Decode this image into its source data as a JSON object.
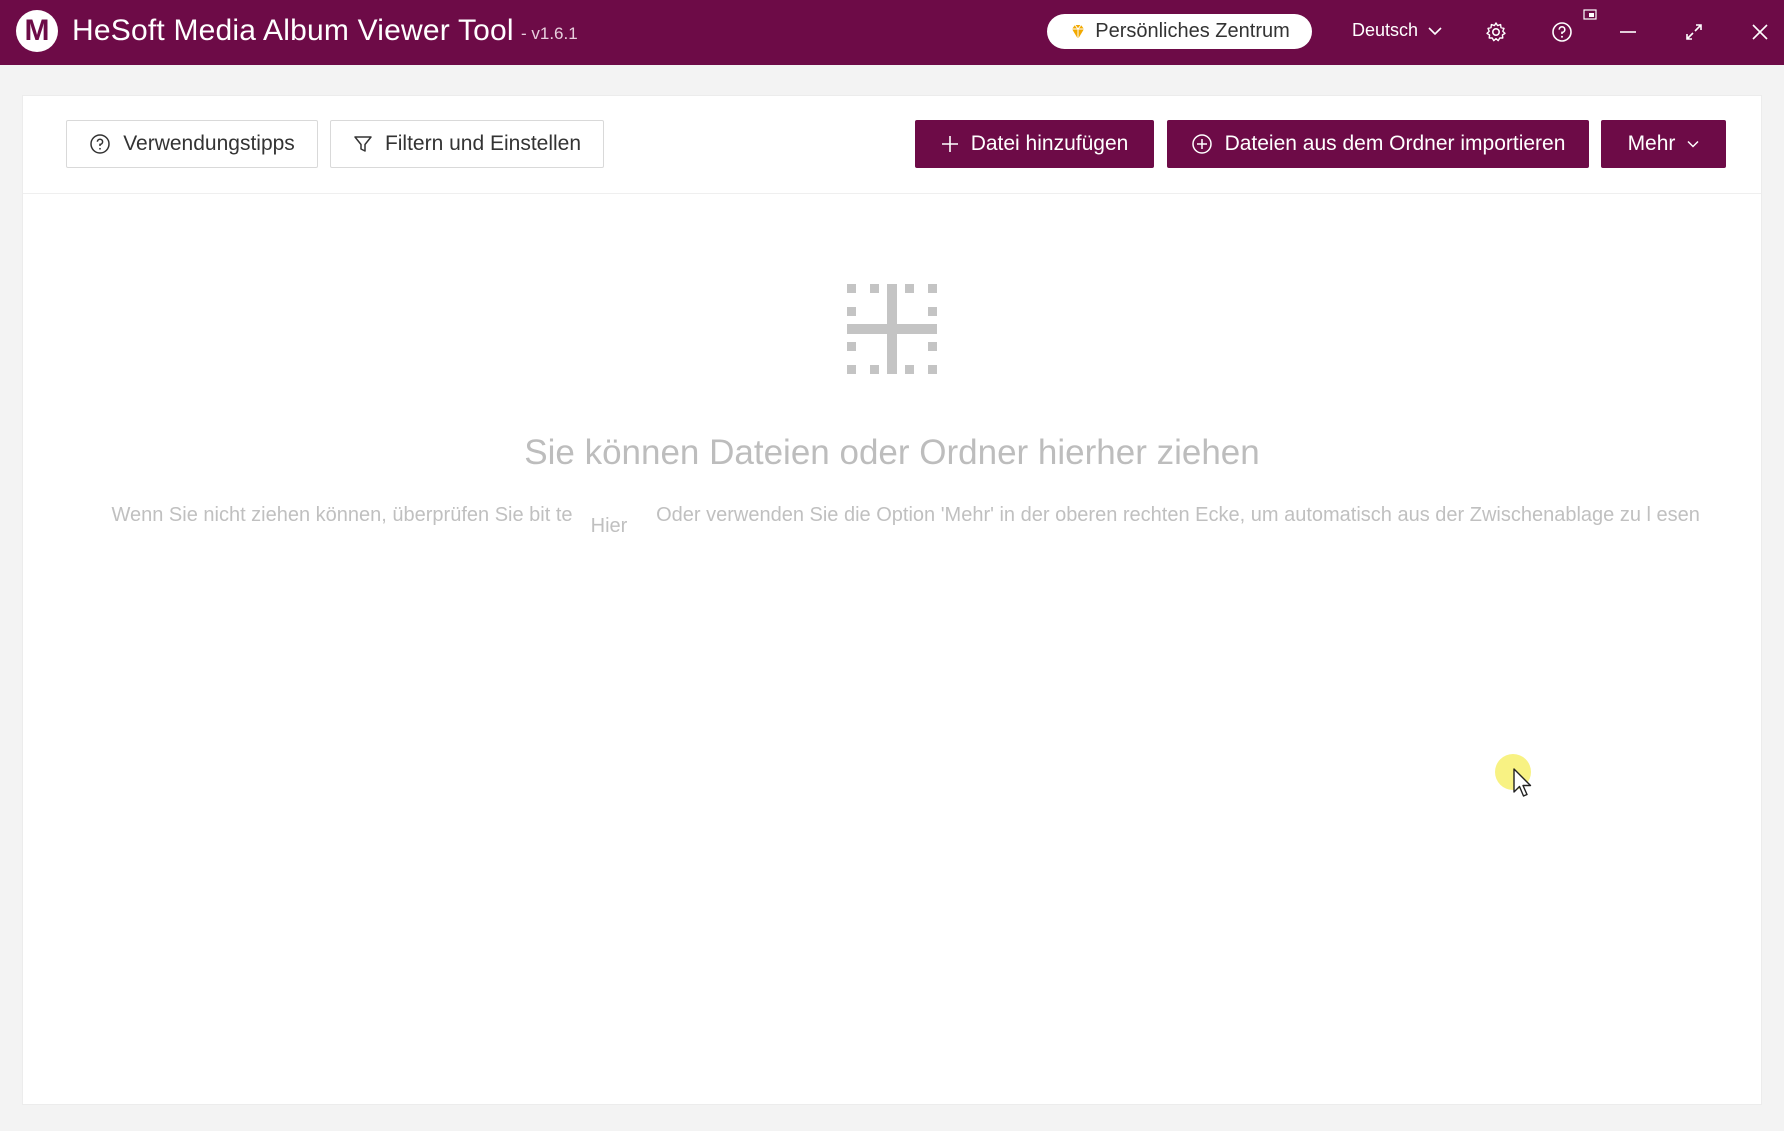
{
  "titlebar": {
    "logo_letter": "M",
    "app_title": "HeSoft Media Album Viewer Tool",
    "version": "- v1.6.1",
    "personal_center": "Persönliches Zentrum",
    "language": "Deutsch",
    "icons": [
      "gem-icon",
      "chevron-down-icon",
      "gear-icon",
      "help-icon",
      "window-icon",
      "minimize-icon",
      "maximize-icon",
      "close-icon"
    ],
    "accent_color": "#6d0b47"
  },
  "toolbar": {
    "tips_label": "Verwendungstipps",
    "filter_label": "Filtern und Einstellen",
    "add_file_label": "Datei hinzufügen",
    "import_folder_label": "Dateien aus dem Ordner importieren",
    "more_label": "Mehr"
  },
  "empty_state": {
    "title": "Sie können Dateien oder Ordner hierher ziehen",
    "hint_left": "Wenn Sie nicht ziehen können, überprüfen Sie bit te",
    "hint_link": "Hier",
    "hint_right": "Oder verwenden Sie die Option 'Mehr' in der oberen rechten Ecke, um automatisch aus der Zwischenablage zu l esen"
  }
}
